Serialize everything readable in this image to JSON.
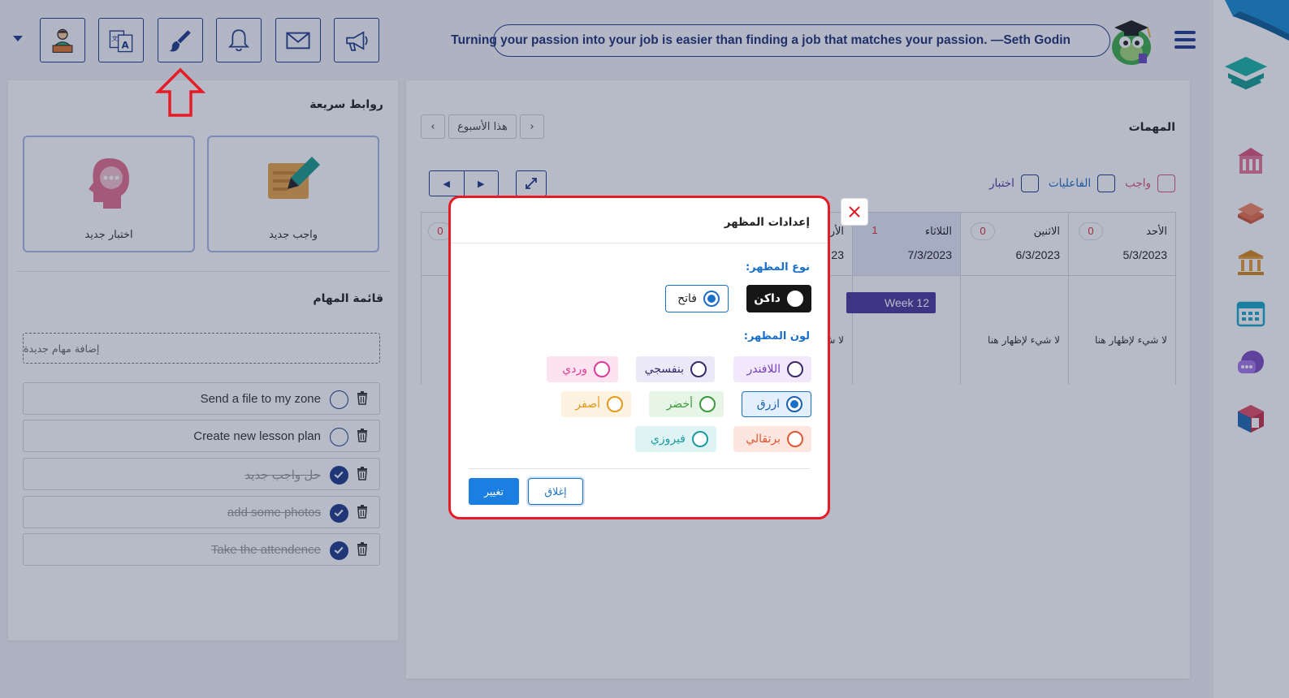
{
  "header": {
    "quote": "Turning your passion into your job is easier than finding a job that matches your passion. —Seth Godin",
    "toolbar": [
      "profile-icon",
      "translate-icon",
      "brush-icon",
      "bell-icon",
      "mail-icon",
      "megaphone-icon"
    ]
  },
  "quick_links": {
    "title": "روابط سريعة",
    "new_homework": "واجب جديد",
    "new_quiz": "اختبار جديد"
  },
  "task_list": {
    "title": "قائمة المهام",
    "add_placeholder": "إضافة مهام جديدة",
    "items": [
      {
        "text": "Send a file to my zone",
        "done": false
      },
      {
        "text": "Create new lesson plan",
        "done": false
      },
      {
        "text": "حل واجب جديد",
        "done": true
      },
      {
        "text": "add some photos",
        "done": true
      },
      {
        "text": "Take the attendence",
        "done": true
      }
    ]
  },
  "tasks": {
    "title": "المهمات",
    "this_week": "هذا الأسبوع",
    "filters": {
      "homework": "واجب",
      "activities": "الفاعليات",
      "quiz": "اختبار"
    },
    "columns": [
      {
        "day": "الأحد",
        "date": "5/3/2023",
        "count": "0",
        "empty": "لا شيء لإظهار هنا"
      },
      {
        "day": "الاثنين",
        "date": "6/3/2023",
        "count": "0",
        "empty": "لا شيء لإظهار هنا"
      },
      {
        "day": "الثلاثاء",
        "date": "7/3/2023",
        "count": "1",
        "empty": ""
      },
      {
        "day": "الأر",
        "date": "23",
        "count": "",
        "empty": "لا ش"
      },
      {
        "day": "",
        "date": "",
        "count": "0",
        "empty": ""
      }
    ],
    "week_badge": "Week 12"
  },
  "modal": {
    "title": "إعدادات المظهر",
    "theme_type_label": "نوع المظهر:",
    "theme_types": [
      {
        "label": "داكن",
        "selected": false
      },
      {
        "label": "فاتح",
        "selected": true
      }
    ],
    "theme_color_label": "لون المظهر:",
    "colors": [
      {
        "label": "اللافندر",
        "text": "#7a3fb8",
        "bg": "#f1e9fb",
        "selected": false
      },
      {
        "label": "بنفسجي",
        "text": "#3a2a6b",
        "bg": "#ebe9f7",
        "selected": false
      },
      {
        "label": "وردي",
        "text": "#e0399b",
        "bg": "#fde3ef",
        "selected": false
      },
      {
        "label": "ازرق",
        "text": "#1a5fb0",
        "bg": "#e3effa",
        "selected": true
      },
      {
        "label": "أخضر",
        "text": "#3d9a3d",
        "bg": "#e6f5e6",
        "selected": false
      },
      {
        "label": "أصفر",
        "text": "#e39a1b",
        "bg": "#fdf1df",
        "selected": false
      },
      {
        "label": "برتقالي",
        "text": "#e4572e",
        "bg": "#fde6e0",
        "selected": false
      },
      {
        "label": "فيروزي",
        "text": "#1a9ba1",
        "bg": "#def3f4",
        "selected": false
      }
    ],
    "change_button": "تغيير",
    "close_button": "إغلاق"
  },
  "colors": {
    "accent": "#1f3d8a",
    "danger": "#e61b26"
  }
}
